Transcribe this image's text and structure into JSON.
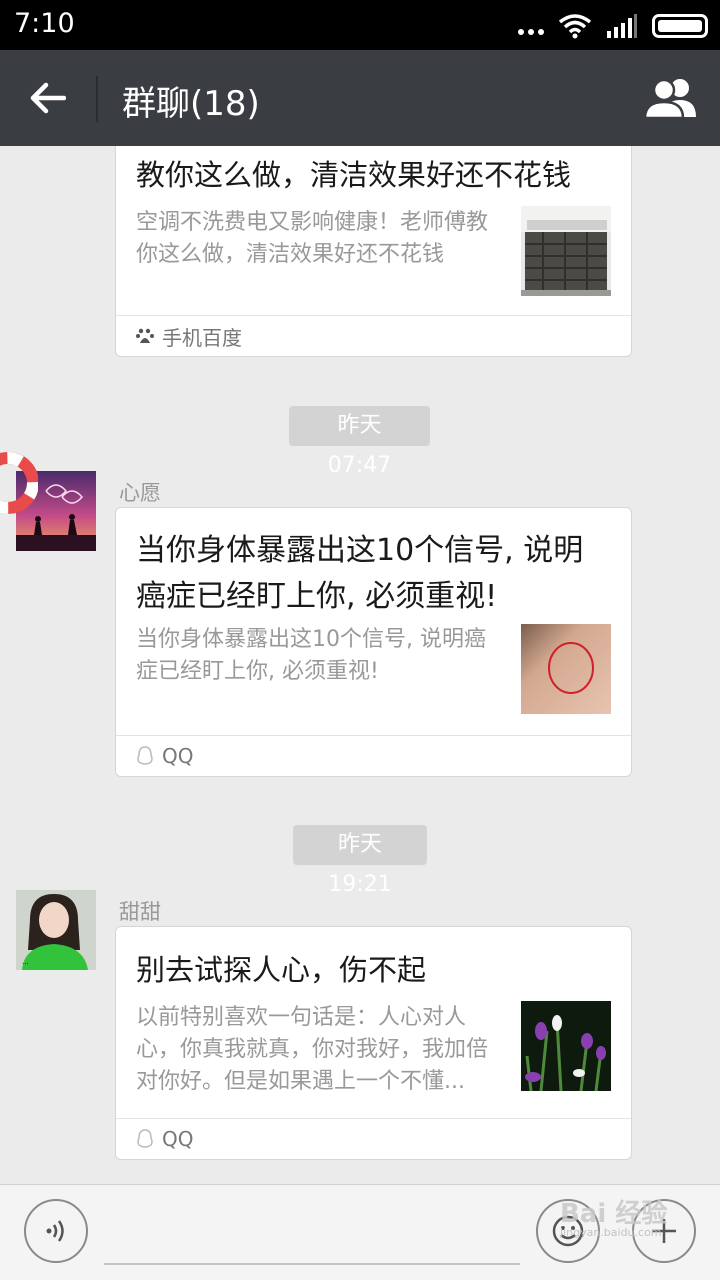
{
  "status_bar": {
    "time": "7:10"
  },
  "header": {
    "title": "群聊(18)",
    "back_icon": "arrow-left-icon",
    "members_icon": "group-members-icon"
  },
  "messages": [
    {
      "type": "link_card",
      "title": "教你这么做，清洁效果好还不花钱",
      "description": "空调不洗费电又影响健康！老师傅教你这么做，清洁效果好还不花钱",
      "source": "手机百度",
      "source_icon": "baidu-paw-icon",
      "thumb": "air-conditioner-thumbnail"
    },
    {
      "type": "timestamp",
      "text": "昨天 07:47"
    },
    {
      "type": "link_card",
      "sender": "心愿",
      "avatar": "sunset-couple-avatar",
      "title": "当你身体暴露出这10个信号, 说明癌症已经盯上你, 必须重视!",
      "description": "当你身体暴露出这10个信号, 说明癌症已经盯上你, 必须重视!",
      "source": "QQ",
      "source_icon": "qq-penguin-icon",
      "thumb": "skin-circle-thumbnail"
    },
    {
      "type": "timestamp",
      "text": "昨天 19:21"
    },
    {
      "type": "link_card",
      "sender": "甜甜",
      "avatar": "girl-green-shirt-avatar",
      "title": "别去试探人心，伤不起",
      "description": "以前特别喜欢一句话是：人心对人心，你真我就真，你对我好，我加倍对你好。但是如果遇上一个不懂...",
      "source": "QQ",
      "source_icon": "qq-penguin-icon",
      "thumb": "iris-flowers-thumbnail"
    }
  ],
  "input_bar": {
    "voice_icon": "voice-wave-icon",
    "emoji_icon": "emoji-face-icon",
    "plus_icon": "plus-icon"
  },
  "watermark": {
    "text": "Bai 经验",
    "url": "jingyan.baidu.com"
  }
}
